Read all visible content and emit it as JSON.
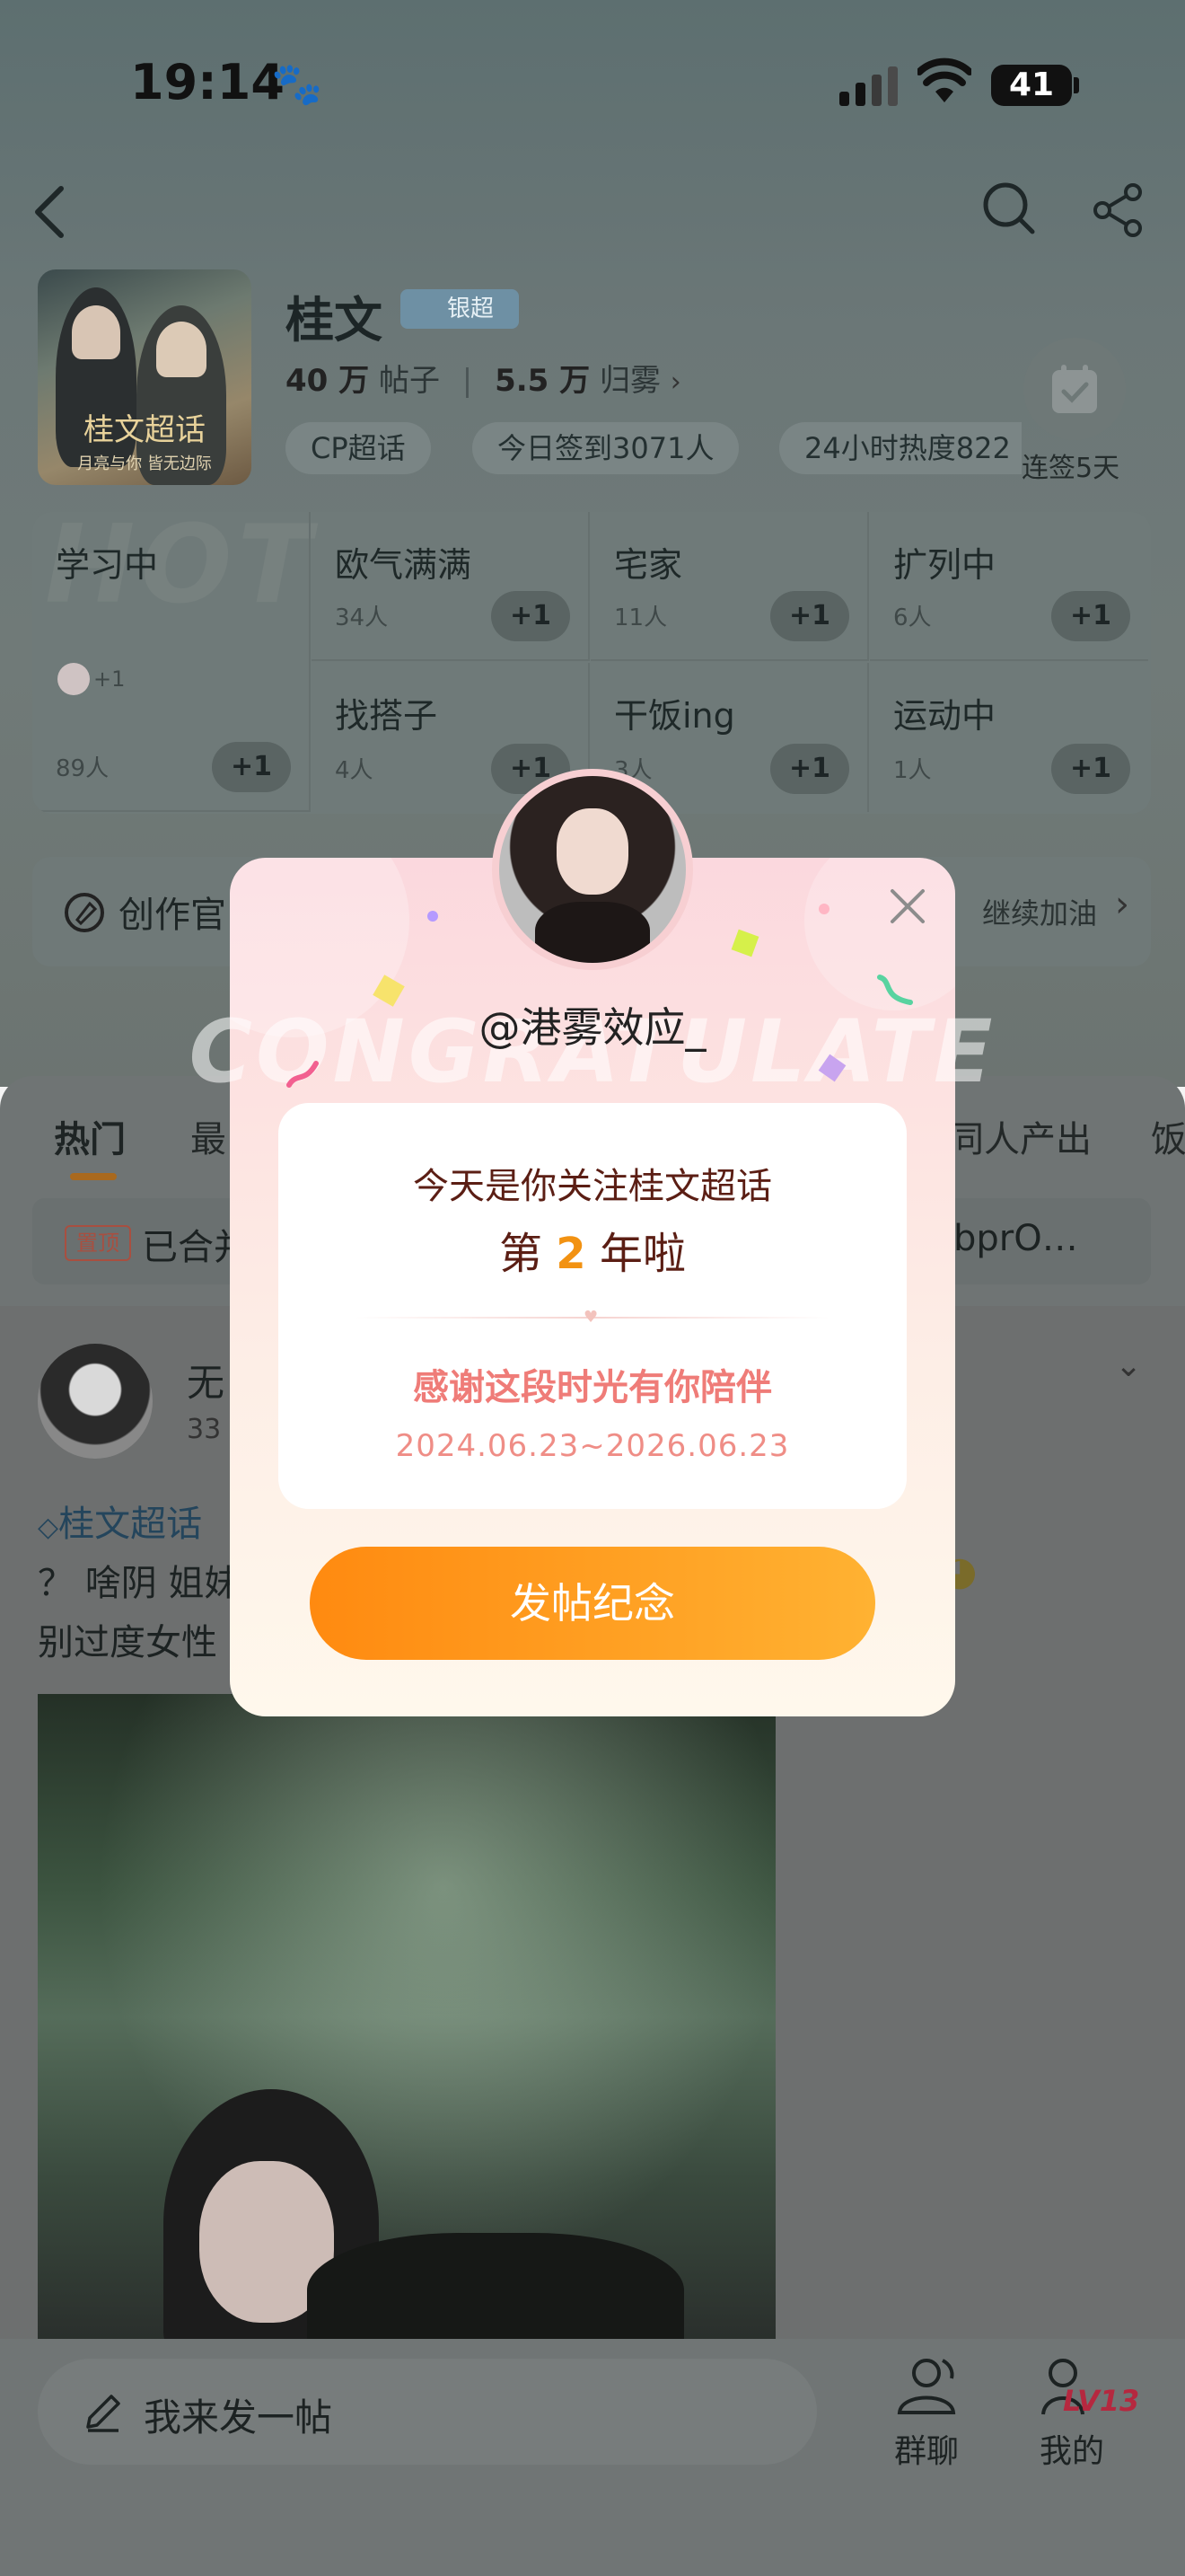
{
  "status_bar": {
    "time": "19:14",
    "paw_glyph": "🐾",
    "battery": "41"
  },
  "header": {
    "title": "桂文",
    "badge": "银超",
    "posts_count": "40 万",
    "posts_unit": "帖子",
    "fans_count": "5.5 万",
    "fans_unit": "归雾",
    "chips": [
      "CP超话",
      "今日签到3071人",
      "24小时热度822"
    ],
    "checkin_label": "连签5天",
    "cover_title": "桂文超话",
    "cover_sub": "月亮与你  皆无边际"
  },
  "grid": {
    "watermark": "HOT",
    "cells": [
      {
        "name": "学习中",
        "count": "89人",
        "btn": "+1"
      },
      {
        "name": "欧气满满",
        "count": "34人",
        "btn": "+1"
      },
      {
        "name": "宅家",
        "count": "11人",
        "btn": "+1"
      },
      {
        "name": "扩列中",
        "count": "6人",
        "btn": "+1"
      },
      {
        "name": "找搭子",
        "count": "4人",
        "btn": "+1"
      },
      {
        "name": "干饭ing",
        "count": "3人",
        "btn": "+1"
      },
      {
        "name": "运动中",
        "count": "1人",
        "btn": "+1"
      }
    ],
    "first_cell_extra": "+1"
  },
  "creator": {
    "label": "创作官",
    "right": "继续加油"
  },
  "feed": {
    "tabs": [
      "热门",
      "最",
      "同人产出",
      "饭"
    ],
    "pin_tag": "置顶",
    "pin_text_left": "已合并",
    "pin_text_right": "bprO…",
    "post_user": "无",
    "post_meta": "33",
    "post_topic": "桂文超话",
    "post_line1": "？ 啥阴 姐妹",
    "post_line2": "别过度女性"
  },
  "bottom": {
    "compose": "我来发一帖",
    "group": "群聊",
    "mine": "我的",
    "level": "LV13"
  },
  "popup": {
    "user": "@港雾效应_",
    "watermark": "CONGRATULATE",
    "line1": "今天是你关注桂文超话",
    "line2_pre": "第",
    "line2_num": "2",
    "line2_post": "年啦",
    "thanks": "感谢这段时光有你陪伴",
    "dates": "2024.06.23~2026.06.23",
    "button": "发帖纪念"
  }
}
